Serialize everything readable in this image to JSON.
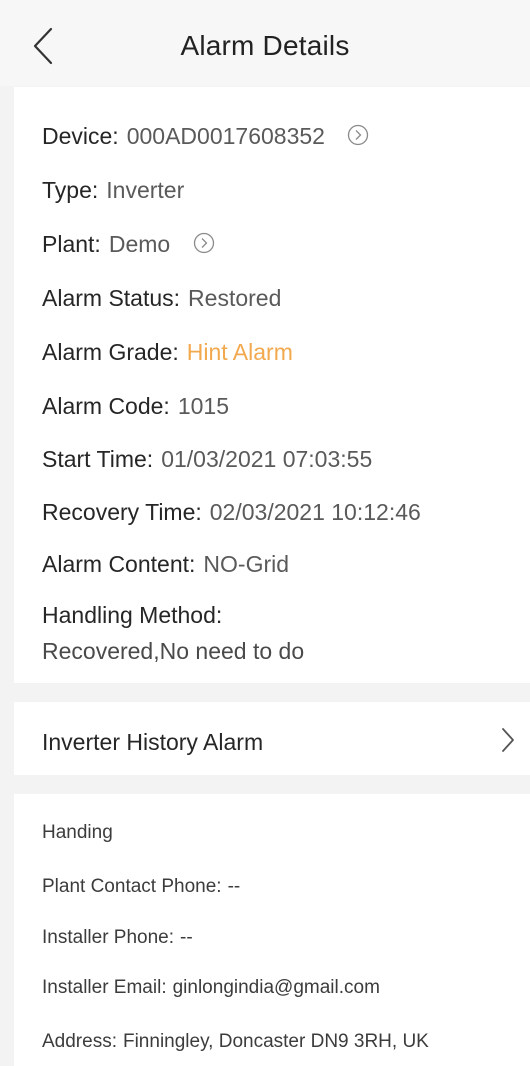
{
  "header": {
    "title": "Alarm Details",
    "back_icon": "chevron-left-icon"
  },
  "details": {
    "device": {
      "label": "Device:",
      "value": "000AD0017608352"
    },
    "type": {
      "label": "Type:",
      "value": "Inverter"
    },
    "plant": {
      "label": "Plant:",
      "value": "Demo"
    },
    "status": {
      "label": "Alarm Status:",
      "value": "Restored"
    },
    "grade": {
      "label": "Alarm Grade:",
      "value": "Hint Alarm",
      "color": "#f2a94d"
    },
    "code": {
      "label": "Alarm Code:",
      "value": "1015"
    },
    "start": {
      "label": "Start Time:",
      "value": "01/03/2021 07:03:55"
    },
    "recovery": {
      "label": "Recovery Time:",
      "value": "02/03/2021 10:12:46"
    },
    "content": {
      "label": "Alarm Content:",
      "value": "NO-Grid"
    },
    "method": {
      "label": "Handling Method:",
      "value": "Recovered,No need to do"
    }
  },
  "history": {
    "label": "Inverter History Alarm"
  },
  "handing": {
    "title": "Handing",
    "plant_phone": {
      "label": "Plant Contact Phone:",
      "value": "--"
    },
    "installer_phone": {
      "label": "Installer Phone:",
      "value": "--"
    },
    "installer_email": {
      "label": "Installer Email:",
      "value": "ginlongindia@gmail.com"
    },
    "address": {
      "label": "Address:",
      "value": "Finningley, Doncaster DN9 3RH, UK"
    }
  }
}
